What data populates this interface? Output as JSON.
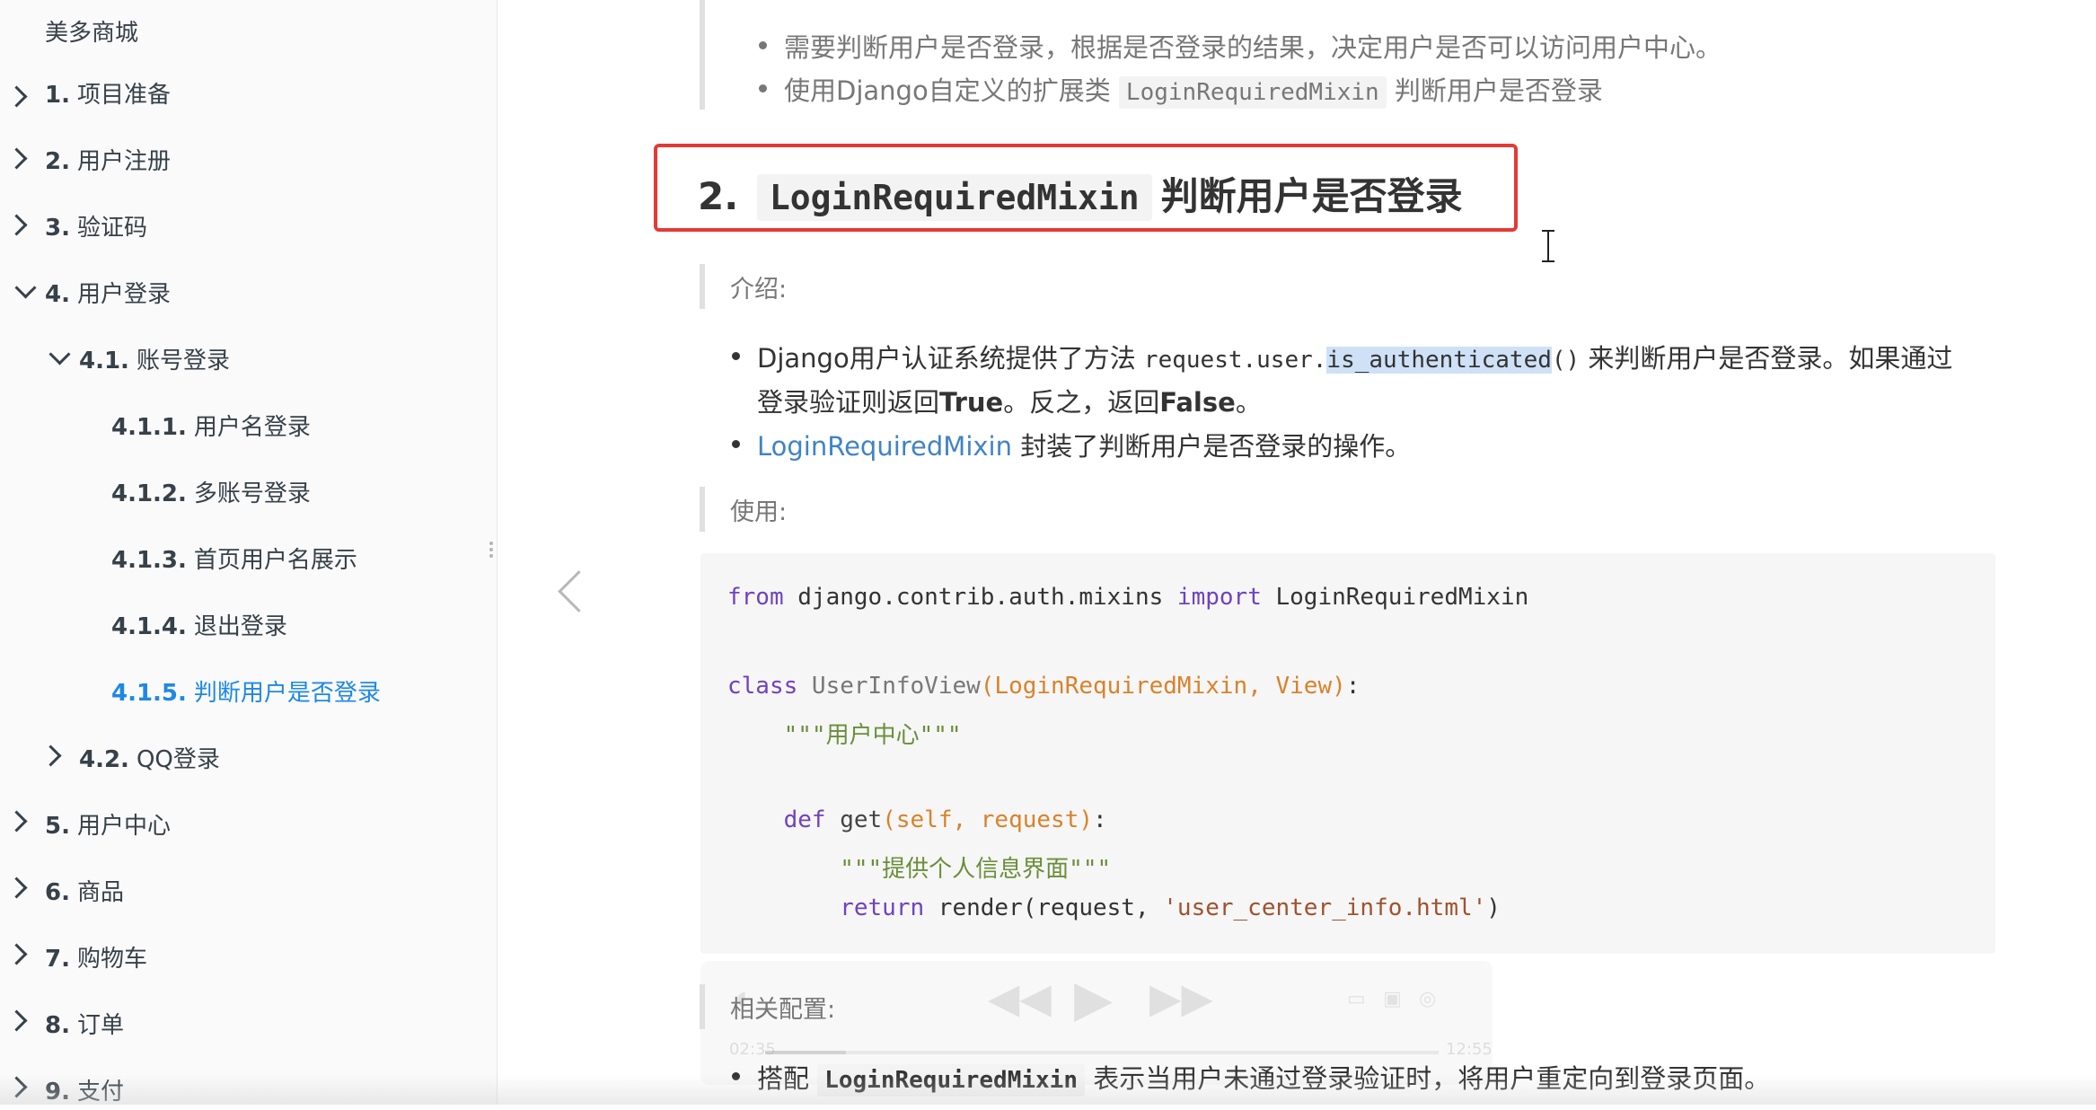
{
  "sidebar": {
    "title": "美多商城",
    "items": [
      {
        "num": "1.",
        "label": "项目准备"
      },
      {
        "num": "2.",
        "label": "用户注册"
      },
      {
        "num": "3.",
        "label": "验证码"
      },
      {
        "num": "4.",
        "label": "用户登录"
      },
      {
        "num": "4.1.",
        "label": "账号登录"
      },
      {
        "num": "4.1.1.",
        "label": "用户名登录"
      },
      {
        "num": "4.1.2.",
        "label": "多账号登录"
      },
      {
        "num": "4.1.3.",
        "label": "首页用户名展示"
      },
      {
        "num": "4.1.4.",
        "label": "退出登录"
      },
      {
        "num": "4.1.5.",
        "label": "判断用户是否登录"
      },
      {
        "num": "4.2.",
        "label": "QQ登录"
      },
      {
        "num": "5.",
        "label": "用户中心"
      },
      {
        "num": "6.",
        "label": "商品"
      },
      {
        "num": "7.",
        "label": "购物车"
      },
      {
        "num": "8.",
        "label": "订单"
      },
      {
        "num": "9.",
        "label": "支付"
      }
    ]
  },
  "content": {
    "top_bullets": [
      {
        "text": "需要判断用户是否登录，根据是否登录的结果，决定用户是否可以访问用户中心。"
      },
      {
        "pre": "使用Django自定义的扩展类 ",
        "code": "LoginRequiredMixin",
        "post": " 判断用户是否登录"
      }
    ],
    "heading": {
      "num": "2.",
      "code": "LoginRequiredMixin",
      "text": "判断用户是否登录"
    },
    "intro_label": "介绍:",
    "intro_bullets": {
      "b1_pre": "Django用户认证系统提供了方法 ",
      "b1_code_a": "request.user.",
      "b1_code_sel": "is_authenticated",
      "b1_code_b": "()",
      "b1_post": " 来判断用户是否登录。如果通过",
      "b1_line2_a": "登录验证则返回",
      "b1_true": "True",
      "b1_line2_b": "。反之，返回",
      "b1_false": "False",
      "b1_line2_c": "。",
      "b2_link": "LoginRequiredMixin",
      "b2_text": " 封装了判断用户是否登录的操作。"
    },
    "usage_label": "使用:",
    "code": {
      "l1_from": "from",
      "l1_mod": " django.contrib.auth.mixins ",
      "l1_import": "import",
      "l1_name": " LoginRequiredMixin",
      "l2_class": "class",
      "l2_name": " UserInfoView",
      "l2_args": "(LoginRequiredMixin, View)",
      "l2_colon": ":",
      "l3_doc": "    \"\"\"用户中心\"\"\"",
      "l4_def": "    def",
      "l4_name": " get",
      "l4_args": "(self, request)",
      "l4_colon": ":",
      "l5_doc": "        \"\"\"提供个人信息界面\"\"\"",
      "l6_return": "        return",
      "l6_call": " render(request, ",
      "l6_str": "'user_center_info.html'",
      "l6_end": ")"
    },
    "config_label": "相关配置:",
    "last_bullet": {
      "pre": "搭配 ",
      "code": "LoginRequiredMixin",
      "post": " 表示当用户未通过登录验证时，将用户重定向到登录页面。"
    }
  },
  "video": {
    "current": "02:35",
    "total": "12:55",
    "progress": 0.12
  }
}
